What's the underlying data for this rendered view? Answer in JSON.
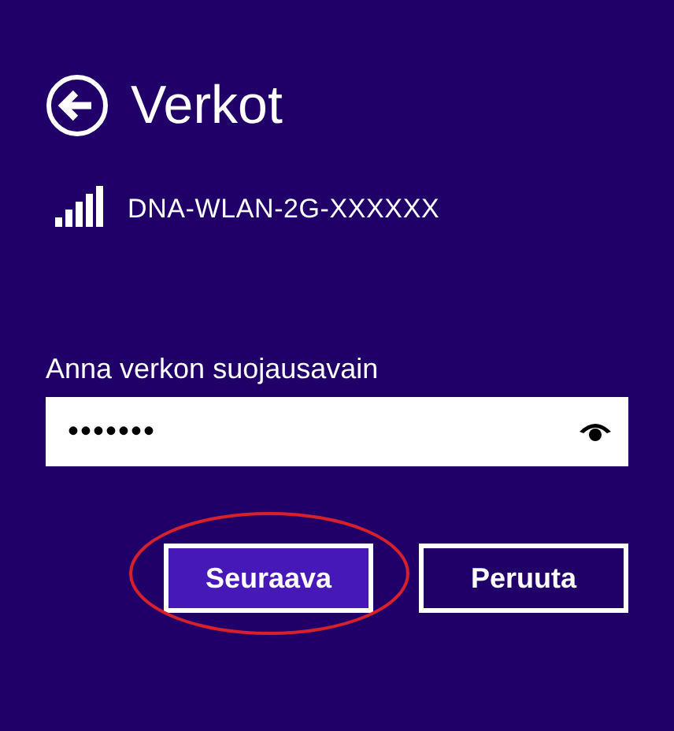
{
  "header": {
    "title": "Verkot"
  },
  "network": {
    "name": "DNA-WLAN-2G-XXXXXX"
  },
  "key_field": {
    "label": "Anna verkon suojausavain",
    "value": "•••••••"
  },
  "buttons": [
    {
      "label": "Seuraava",
      "kind": "primary",
      "highlighted": true
    },
    {
      "label": "Peruuta",
      "kind": "secondary",
      "highlighted": false
    }
  ]
}
